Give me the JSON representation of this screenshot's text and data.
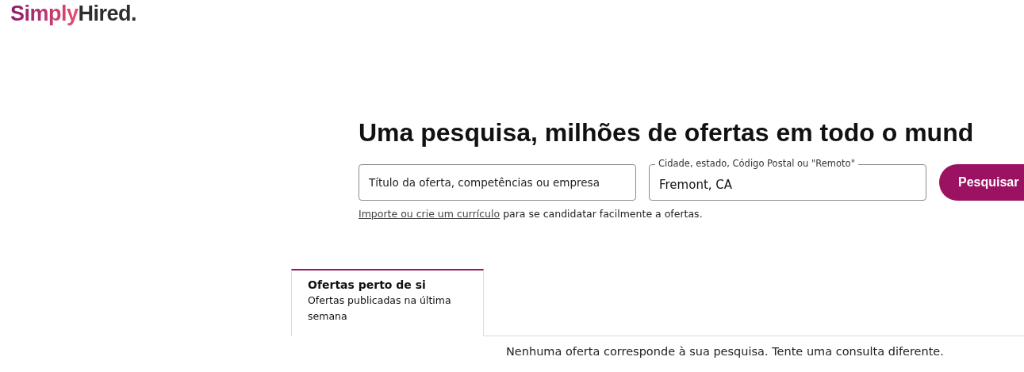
{
  "logo": {
    "first": "Simply",
    "second": "Hired."
  },
  "heading": "Uma pesquisa, milhões de ofertas em todo o mund",
  "search": {
    "what": {
      "placeholder": "Título da oferta, competências ou empresa"
    },
    "where": {
      "label": "Cidade, estado, Código Postal ou \"Remoto\"",
      "value": "Fremont, CA"
    },
    "button": "Pesquisar"
  },
  "resume_hint": {
    "link": "Importe ou crie um currículo",
    "text": "para se candidatar facilmente a ofertas."
  },
  "tabs": [
    {
      "title": "Ofertas perto de si",
      "subtitle": "Ofertas publicadas na última semana",
      "selected": true
    }
  ],
  "message": "Nenhuma oferta corresponde à sua pesquisa. Tente uma consulta diferente."
}
